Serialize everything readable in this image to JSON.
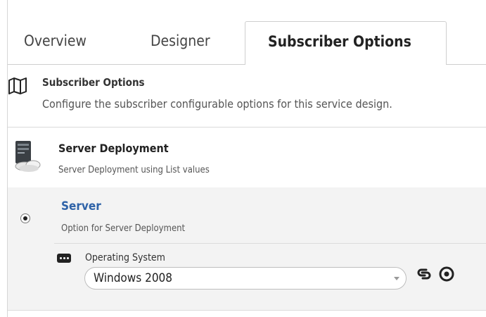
{
  "tabs": {
    "overview": "Overview",
    "designer": "Designer",
    "subscriber_options": "Subscriber Options"
  },
  "section": {
    "title": "Subscriber Options",
    "description": "Configure the subscriber configurable options for this service design.",
    "icon": "map-icon"
  },
  "service": {
    "title": "Server Deployment",
    "description": "Server Deployment using List values",
    "icon": "server-cloud-icon"
  },
  "option": {
    "title": "Server",
    "description": "Option for  Server  Deployment",
    "selected": true,
    "field": {
      "label": "Operating System",
      "value": "Windows 2008",
      "icon": "list-field-icon"
    },
    "actions": [
      "link-icon",
      "view-icon"
    ]
  },
  "colors": {
    "accent": "#2f63a8",
    "panel": "#f3f3f3"
  }
}
